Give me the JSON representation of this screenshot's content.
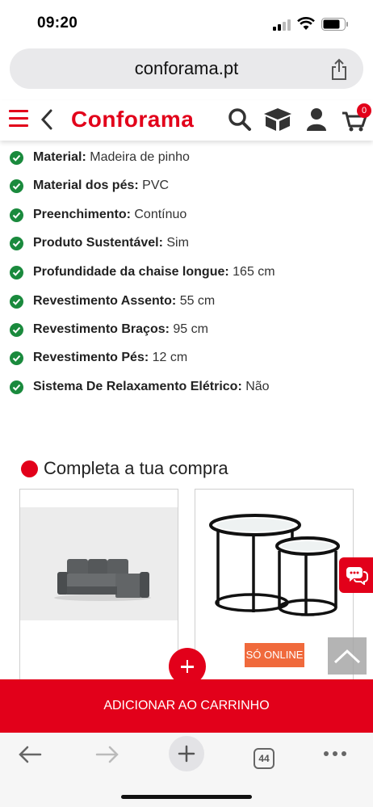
{
  "status_bar": {
    "time": "09:20"
  },
  "browser": {
    "url": "conforama.pt",
    "tabs_count": "44"
  },
  "header": {
    "logo": "Conforama",
    "cart_count": "0"
  },
  "specs": [
    {
      "label": "Material:",
      "value": "Madeira de pinho"
    },
    {
      "label": "Material dos pés:",
      "value": "PVC"
    },
    {
      "label": "Preenchimento:",
      "value": "Contínuo"
    },
    {
      "label": "Produto Sustentável:",
      "value": "Sim"
    },
    {
      "label": "Profundidade da chaise longue:",
      "value": "165 cm"
    },
    {
      "label": "Revestimento Assento:",
      "value": "55 cm"
    },
    {
      "label": "Revestimento Braços:",
      "value": "95 cm"
    },
    {
      "label": "Revestimento Pés:",
      "value": "12 cm"
    },
    {
      "label": "Sistema De Relaxamento Elétrico:",
      "value": "Não"
    }
  ],
  "complete_purchase": {
    "title": "Completa a tua compra",
    "badge": "SÓ ONLINE"
  },
  "cart_button": "ADICIONAR AO CARRINHO",
  "colors": {
    "brand": "#e2001a",
    "check": "#1a8a3d",
    "badge": "#f06a3c"
  },
  "icons": [
    "menu-icon",
    "back-icon",
    "search-icon",
    "box-icon",
    "user-icon",
    "cart-icon",
    "share-icon",
    "chat-icon",
    "chevron-up-icon",
    "plus-icon"
  ]
}
